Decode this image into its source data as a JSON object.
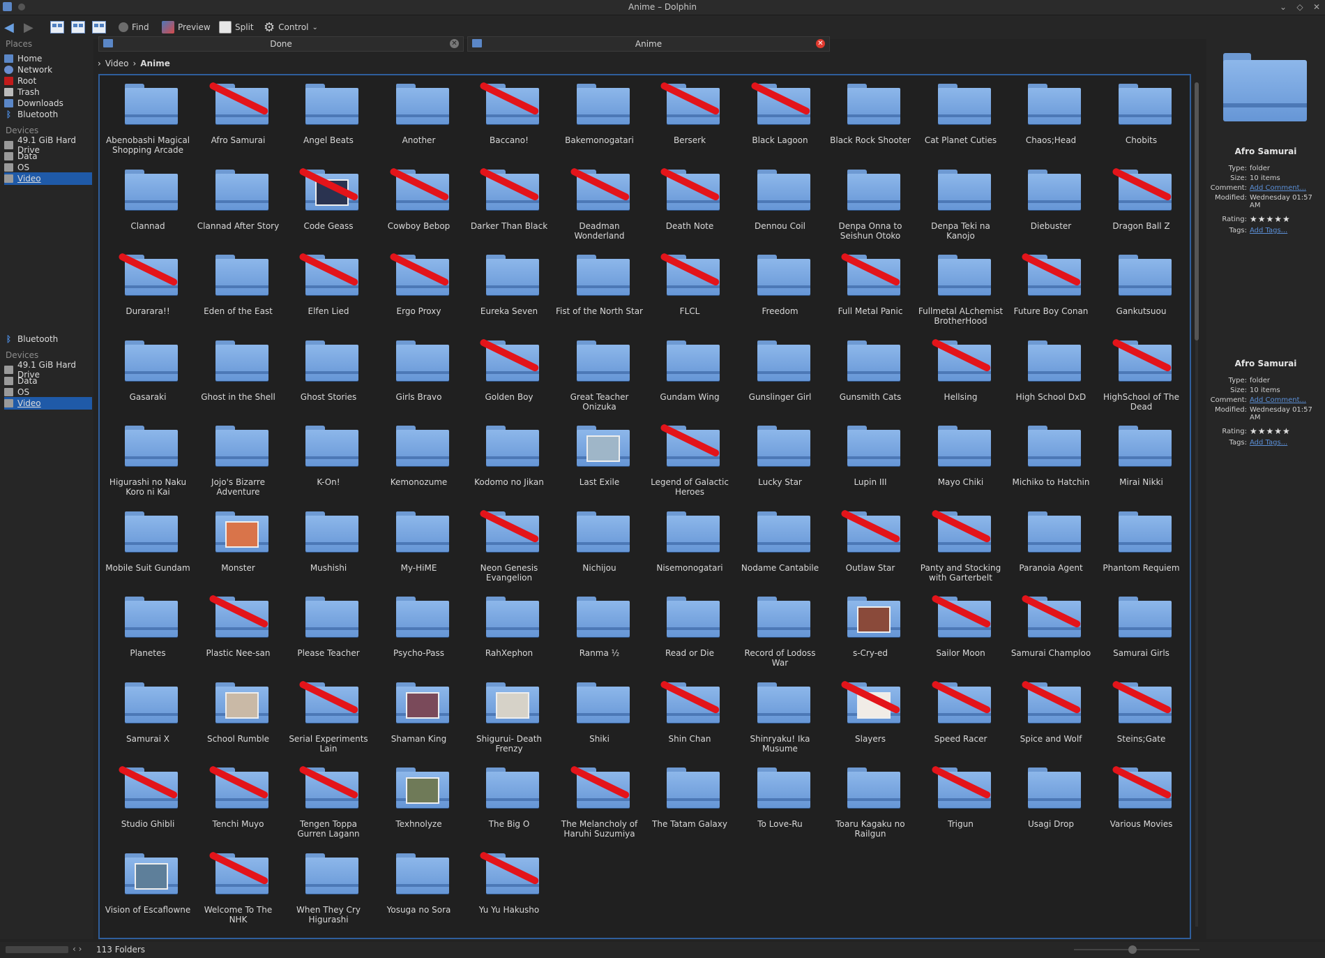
{
  "window": {
    "title": "Anime – Dolphin"
  },
  "toolbar": {
    "find_label": "Find",
    "preview_label": "Preview",
    "split_label": "Split",
    "control_label": "Control"
  },
  "places_panel": {
    "places_heading": "Places",
    "places": [
      {
        "label": "Home",
        "color": "#5b87c7"
      },
      {
        "label": "Network",
        "color": "#6a8ecf"
      },
      {
        "label": "Root",
        "color": "#c01a1a"
      },
      {
        "label": "Trash",
        "color": "#bbbbbb"
      },
      {
        "label": "Downloads",
        "color": "#5b87c7"
      },
      {
        "label": "Bluetooth",
        "color": "#4a86d6"
      }
    ],
    "devices_heading": "Devices",
    "devices": [
      {
        "label": "49.1 GiB Hard Drive",
        "selected": false
      },
      {
        "label": "Data",
        "selected": false
      },
      {
        "label": "OS",
        "selected": false
      },
      {
        "label": "Video",
        "selected": true
      }
    ],
    "places2": [
      {
        "label": "Bluetooth",
        "color": "#4a86d6"
      }
    ],
    "devices_heading2": "Devices",
    "devices2": [
      {
        "label": "49.1 GiB Hard Drive",
        "selected": false
      },
      {
        "label": "Data",
        "selected": false
      },
      {
        "label": "OS",
        "selected": false
      },
      {
        "label": "Video",
        "selected": true
      }
    ]
  },
  "tabs": [
    {
      "label": "Done"
    },
    {
      "label": "Anime"
    }
  ],
  "breadcrumb": {
    "parent": "Video",
    "current": "Anime"
  },
  "folders": [
    {
      "name": "Abenobashi Magical Shopping Arcade",
      "struck": false
    },
    {
      "name": "Afro Samurai",
      "struck": true
    },
    {
      "name": "Angel Beats",
      "struck": false
    },
    {
      "name": "Another",
      "struck": false
    },
    {
      "name": "Baccano!",
      "struck": true
    },
    {
      "name": "Bakemonogatari",
      "struck": false
    },
    {
      "name": "Berserk",
      "struck": true
    },
    {
      "name": "Black Lagoon",
      "struck": true
    },
    {
      "name": "Black Rock Shooter",
      "struck": false
    },
    {
      "name": "Cat Planet Cuties",
      "struck": false
    },
    {
      "name": "Chaos;Head",
      "struck": false
    },
    {
      "name": "Chobits",
      "struck": false
    },
    {
      "name": "Clannad",
      "struck": false
    },
    {
      "name": "Clannad After Story",
      "struck": false
    },
    {
      "name": "Code Geass",
      "struck": true,
      "thumb": "#2a3350"
    },
    {
      "name": "Cowboy Bebop",
      "struck": true
    },
    {
      "name": "Darker Than Black",
      "struck": true
    },
    {
      "name": "Deadman Wonderland",
      "struck": true
    },
    {
      "name": "Death Note",
      "struck": true
    },
    {
      "name": "Dennou Coil",
      "struck": false
    },
    {
      "name": "Denpa Onna to Seishun Otoko",
      "struck": false
    },
    {
      "name": "Denpa Teki na Kanojo",
      "struck": false
    },
    {
      "name": "Diebuster",
      "struck": false
    },
    {
      "name": "Dragon Ball Z",
      "struck": true
    },
    {
      "name": "Durarara!!",
      "struck": true
    },
    {
      "name": "Eden of the East",
      "struck": false
    },
    {
      "name": "Elfen Lied",
      "struck": true
    },
    {
      "name": "Ergo Proxy",
      "struck": true
    },
    {
      "name": "Eureka Seven",
      "struck": false
    },
    {
      "name": "Fist of the North Star",
      "struck": false
    },
    {
      "name": "FLCL",
      "struck": true
    },
    {
      "name": "Freedom",
      "struck": false
    },
    {
      "name": "Full Metal Panic",
      "struck": true
    },
    {
      "name": "Fullmetal ALchemist BrotherHood",
      "struck": false
    },
    {
      "name": "Future Boy Conan",
      "struck": true
    },
    {
      "name": "Gankutsuou",
      "struck": false
    },
    {
      "name": "Gasaraki",
      "struck": false
    },
    {
      "name": "Ghost in the Shell",
      "struck": false
    },
    {
      "name": "Ghost Stories",
      "struck": false
    },
    {
      "name": "Girls Bravo",
      "struck": false
    },
    {
      "name": "Golden Boy",
      "struck": true
    },
    {
      "name": "Great Teacher Onizuka",
      "struck": false
    },
    {
      "name": "Gundam Wing",
      "struck": false
    },
    {
      "name": "Gunslinger Girl",
      "struck": false
    },
    {
      "name": "Gunsmith Cats",
      "struck": false
    },
    {
      "name": "Hellsing",
      "struck": true
    },
    {
      "name": "High School DxD",
      "struck": false
    },
    {
      "name": "HighSchool of The Dead",
      "struck": true
    },
    {
      "name": "Higurashi no Naku Koro ni Kai",
      "struck": false
    },
    {
      "name": "Jojo's Bizarre Adventure",
      "struck": false
    },
    {
      "name": "K-On!",
      "struck": false
    },
    {
      "name": "Kemonozume",
      "struck": false
    },
    {
      "name": "Kodomo no Jikan",
      "struck": false
    },
    {
      "name": "Last Exile",
      "struck": false,
      "thumb": "#9fb6c8"
    },
    {
      "name": "Legend of Galactic Heroes",
      "struck": true
    },
    {
      "name": "Lucky Star",
      "struck": false
    },
    {
      "name": "Lupin III",
      "struck": false
    },
    {
      "name": "Mayo Chiki",
      "struck": false
    },
    {
      "name": "Michiko to Hatchin",
      "struck": false
    },
    {
      "name": "Mirai Nikki",
      "struck": false
    },
    {
      "name": "Mobile Suit Gundam",
      "struck": false
    },
    {
      "name": "Monster",
      "struck": false,
      "thumb": "#d9744a"
    },
    {
      "name": "Mushishi",
      "struck": false
    },
    {
      "name": "My-HiME",
      "struck": false
    },
    {
      "name": "Neon Genesis Evangelion",
      "struck": true
    },
    {
      "name": "Nichijou",
      "struck": false
    },
    {
      "name": "Nisemonogatari",
      "struck": false
    },
    {
      "name": "Nodame Cantabile",
      "struck": false
    },
    {
      "name": "Outlaw Star",
      "struck": true
    },
    {
      "name": "Panty and Stocking with Garterbelt",
      "struck": true
    },
    {
      "name": "Paranoia Agent",
      "struck": false
    },
    {
      "name": "Phantom Requiem",
      "struck": false
    },
    {
      "name": "Planetes",
      "struck": false
    },
    {
      "name": "Plastic Nee-san",
      "struck": true
    },
    {
      "name": "Please Teacher",
      "struck": false
    },
    {
      "name": "Psycho-Pass",
      "struck": false
    },
    {
      "name": "RahXephon",
      "struck": false
    },
    {
      "name": "Ranma ½",
      "struck": false
    },
    {
      "name": "Read or Die",
      "struck": false
    },
    {
      "name": "Record of Lodoss War",
      "struck": false
    },
    {
      "name": "s-Cry-ed",
      "struck": false,
      "thumb": "#8a4a3a"
    },
    {
      "name": "Sailor Moon",
      "struck": true
    },
    {
      "name": "Samurai Champloo",
      "struck": true
    },
    {
      "name": "Samurai Girls",
      "struck": false
    },
    {
      "name": "Samurai X",
      "struck": false
    },
    {
      "name": "School Rumble",
      "struck": false,
      "thumb": "#c9b9a6"
    },
    {
      "name": "Serial Experiments Lain",
      "struck": true
    },
    {
      "name": "Shaman King",
      "struck": false,
      "thumb": "#7a4a5a"
    },
    {
      "name": "Shigurui- Death Frenzy",
      "struck": false,
      "thumb": "#d6d2c8"
    },
    {
      "name": "Shiki",
      "struck": false
    },
    {
      "name": "Shin Chan",
      "struck": true
    },
    {
      "name": "Shinryaku! Ika Musume",
      "struck": false
    },
    {
      "name": "Slayers",
      "struck": true,
      "thumb": "#f1ece6"
    },
    {
      "name": "Speed Racer",
      "struck": true
    },
    {
      "name": "Spice and Wolf",
      "struck": true
    },
    {
      "name": "Steins;Gate",
      "struck": true
    },
    {
      "name": "Studio Ghibli",
      "struck": true
    },
    {
      "name": "Tenchi Muyo",
      "struck": true
    },
    {
      "name": "Tengen Toppa Gurren Lagann",
      "struck": true
    },
    {
      "name": "Texhnolyze",
      "struck": false,
      "thumb": "#6f7a58"
    },
    {
      "name": "The Big O",
      "struck": false
    },
    {
      "name": "The Melancholy of Haruhi Suzumiya",
      "struck": true
    },
    {
      "name": "The Tatam Galaxy",
      "struck": false
    },
    {
      "name": "To Love-Ru",
      "struck": false
    },
    {
      "name": "Toaru Kagaku no Railgun",
      "struck": false
    },
    {
      "name": "Trigun",
      "struck": true
    },
    {
      "name": "Usagi Drop",
      "struck": false
    },
    {
      "name": "Various Movies",
      "struck": true
    },
    {
      "name": "Vision of Escaflowne",
      "struck": false,
      "thumb": "#5e7f9a"
    },
    {
      "name": "Welcome To The NHK",
      "struck": true
    },
    {
      "name": "When They Cry Higurashi",
      "struck": false
    },
    {
      "name": "Yosuga no Sora",
      "struck": false
    },
    {
      "name": "Yu Yu Hakusho",
      "struck": true
    }
  ],
  "info_panels": [
    {
      "title": "Afro Samurai",
      "type_k": "Type:",
      "type_v": "folder",
      "size_k": "Size:",
      "size_v": "10 items",
      "comment_k": "Comment:",
      "comment_v": "Add Comment...",
      "modified_k": "Modified:",
      "modified_v": "Wednesday 01:57 AM",
      "rating_k": "Rating:",
      "rating_v": "★★★★★",
      "tags_k": "Tags:",
      "tags_v": "Add Tags..."
    },
    {
      "title": "Afro Samurai",
      "type_k": "Type:",
      "type_v": "folder",
      "size_k": "Size:",
      "size_v": "10 items",
      "comment_k": "Comment:",
      "comment_v": "Add Comment...",
      "modified_k": "Modified:",
      "modified_v": "Wednesday 01:57 AM",
      "rating_k": "Rating:",
      "rating_v": "★★★★★",
      "tags_k": "Tags:",
      "tags_v": "Add Tags..."
    }
  ],
  "status": {
    "text": "113 Folders"
  }
}
